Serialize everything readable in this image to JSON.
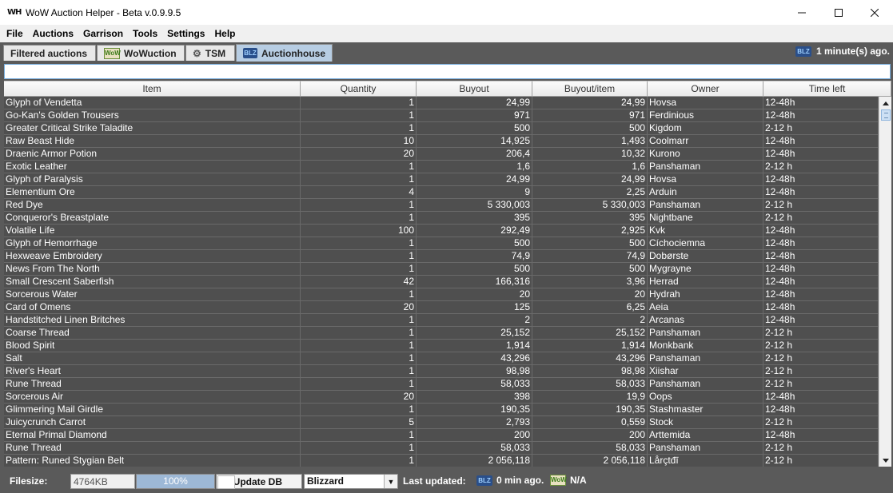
{
  "window": {
    "app_icon": "WH",
    "title": "WoW Auction Helper - Beta v.0.9.9.5",
    "minimize_icon": "minimize-icon",
    "maximize_icon": "maximize-icon",
    "close_icon": "close-icon"
  },
  "menu": [
    "File",
    "Auctions",
    "Garrison",
    "Tools",
    "Settings",
    "Help"
  ],
  "tabs": [
    {
      "label": "Filtered auctions",
      "icon": ""
    },
    {
      "label": "WoWuction",
      "icon": "wowuction-logo-icon"
    },
    {
      "label": "TSM",
      "icon": "gear-icon"
    },
    {
      "label": "Auctionhouse",
      "icon": "blizzard-logo-icon"
    }
  ],
  "active_tab": 3,
  "header_status": {
    "text": "1 minute(s) ago.",
    "icon": "blizzard-logo-icon"
  },
  "filter": {
    "value": ""
  },
  "table": {
    "columns": [
      "Item",
      "Quantity",
      "Buyout",
      "Buyout/item",
      "Owner",
      "Time left"
    ],
    "rows": [
      [
        "Glyph of Vendetta",
        "1",
        "24,99",
        "24,99",
        "Hovsa",
        "12-48h"
      ],
      [
        "Go-Kan's Golden Trousers",
        "1",
        "971",
        "971",
        "Ferdinious",
        "12-48h"
      ],
      [
        "Greater Critical Strike Taladite",
        "1",
        "500",
        "500",
        "Kigdom",
        "2-12 h"
      ],
      [
        "Raw Beast Hide",
        "10",
        "14,925",
        "1,493",
        "Coolmarr",
        "12-48h"
      ],
      [
        "Draenic Armor Potion",
        "20",
        "206,4",
        "10,32",
        "Kurono",
        "12-48h"
      ],
      [
        "Exotic Leather",
        "1",
        "1,6",
        "1,6",
        "Panshaman",
        "2-12 h"
      ],
      [
        "Glyph of Paralysis",
        "1",
        "24,99",
        "24,99",
        "Hovsa",
        "12-48h"
      ],
      [
        "Elementium Ore",
        "4",
        "9",
        "2,25",
        "Arduin",
        "12-48h"
      ],
      [
        "Red Dye",
        "1",
        "5 330,003",
        "5 330,003",
        "Panshaman",
        "2-12 h"
      ],
      [
        "Conqueror's Breastplate",
        "1",
        "395",
        "395",
        "Nightbane",
        "2-12 h"
      ],
      [
        "Volatile Life",
        "100",
        "292,49",
        "2,925",
        "Kvk",
        "12-48h"
      ],
      [
        "Glyph of Hemorrhage",
        "1",
        "500",
        "500",
        "Cíchociemna",
        "12-48h"
      ],
      [
        "Hexweave Embroidery",
        "1",
        "74,9",
        "74,9",
        "Dobørste",
        "12-48h"
      ],
      [
        "News From The North",
        "1",
        "500",
        "500",
        "Mygrayne",
        "12-48h"
      ],
      [
        "Small Crescent Saberfish",
        "42",
        "166,316",
        "3,96",
        "Herrad",
        "12-48h"
      ],
      [
        "Sorcerous Water",
        "1",
        "20",
        "20",
        "Hydrah",
        "12-48h"
      ],
      [
        "Card of Omens",
        "20",
        "125",
        "6,25",
        "Aeia",
        "12-48h"
      ],
      [
        "Handstitched Linen Britches",
        "1",
        "2",
        "2",
        "Arcanas",
        "12-48h"
      ],
      [
        "Coarse Thread",
        "1",
        "25,152",
        "25,152",
        "Panshaman",
        "2-12 h"
      ],
      [
        "Blood Spirit",
        "1",
        "1,914",
        "1,914",
        "Monkbank",
        "2-12 h"
      ],
      [
        "Salt",
        "1",
        "43,296",
        "43,296",
        "Panshaman",
        "2-12 h"
      ],
      [
        "River's Heart",
        "1",
        "98,98",
        "98,98",
        "Xiishar",
        "2-12 h"
      ],
      [
        "Rune Thread",
        "1",
        "58,033",
        "58,033",
        "Panshaman",
        "2-12 h"
      ],
      [
        "Sorcerous Air",
        "20",
        "398",
        "19,9",
        "Oops",
        "12-48h"
      ],
      [
        "Glimmering Mail Girdle",
        "1",
        "190,35",
        "190,35",
        "Stashmaster",
        "12-48h"
      ],
      [
        "Juicycrunch Carrot",
        "5",
        "2,793",
        "0,559",
        "Stock",
        "2-12 h"
      ],
      [
        "Eternal Primal Diamond",
        "1",
        "200",
        "200",
        "Arttemida",
        "12-48h"
      ],
      [
        "Rune Thread",
        "1",
        "58,033",
        "58,033",
        "Panshaman",
        "2-12 h"
      ],
      [
        "Pattern: Runed Stygian Belt",
        "1",
        "2 056,118",
        "2 056,118",
        "Lårçtđī",
        "2-12 h"
      ]
    ]
  },
  "status": {
    "filesize_label": "Filesize:",
    "filesize_value": "4764KB",
    "progress_text": "100%",
    "progress_value": 1.0,
    "update_button": "Update DB",
    "realm_select": "Blizzard",
    "last_updated_label": "Last updated:",
    "blizzard_update": "0 min ago.",
    "wowuction_update": "N/A"
  }
}
